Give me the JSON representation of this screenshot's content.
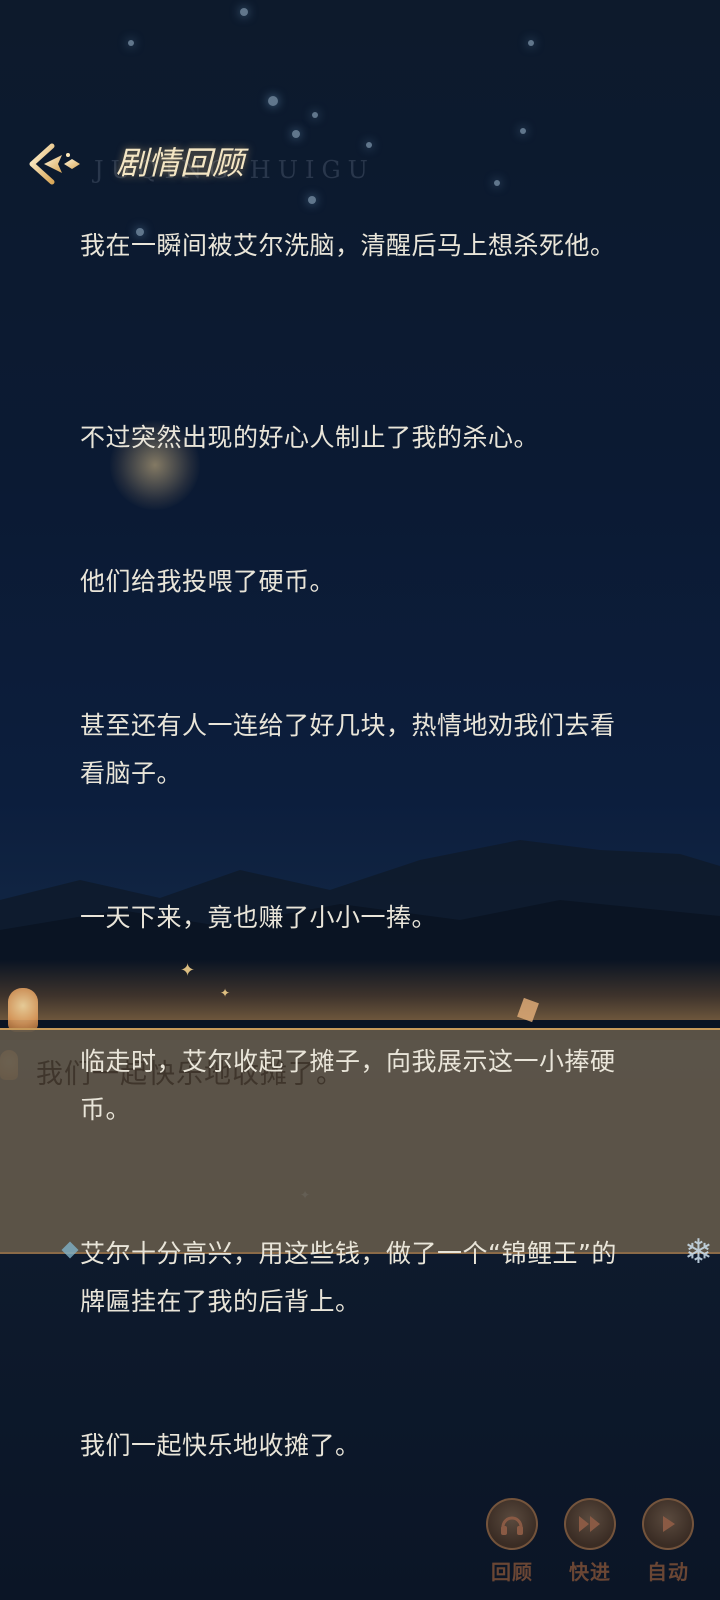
{
  "header": {
    "title": "剧情回顾",
    "title_pinyin": "JUQING HUIGU",
    "back_icon": "back-arrow-icon"
  },
  "story": {
    "paragraphs": [
      "我在一瞬间被艾尔洗脑，清醒后马上想杀死他。",
      "不过突然出现的好心人制止了我的杀心。",
      "他们给我投喂了硬币。",
      "甚至还有人一连给了好几块，热情地劝我们去看看脑子。",
      "一天下来，竟也赚了小小一捧。",
      "临走时，艾尔收起了摊子，向我展示这一小捧硬币。",
      "艾尔十分高兴，用这些钱，做了一个“锦鲤王”的牌匾挂在了我的后背上。",
      "我们一起快乐地收摊了。"
    ]
  },
  "background_dialog": {
    "text": "我们一起快乐地收摊了。"
  },
  "controls": {
    "review_label": "回顾",
    "fast_forward_label": "快进",
    "auto_label": "自动",
    "review_icon": "headphones-icon",
    "fast_forward_icon": "fast-forward-icon",
    "auto_icon": "play-icon"
  },
  "colors": {
    "text": "#e9e5d9",
    "title": "#f4e6c4",
    "accent_gold": "#c79a5a",
    "control_label": "#6a4634"
  }
}
